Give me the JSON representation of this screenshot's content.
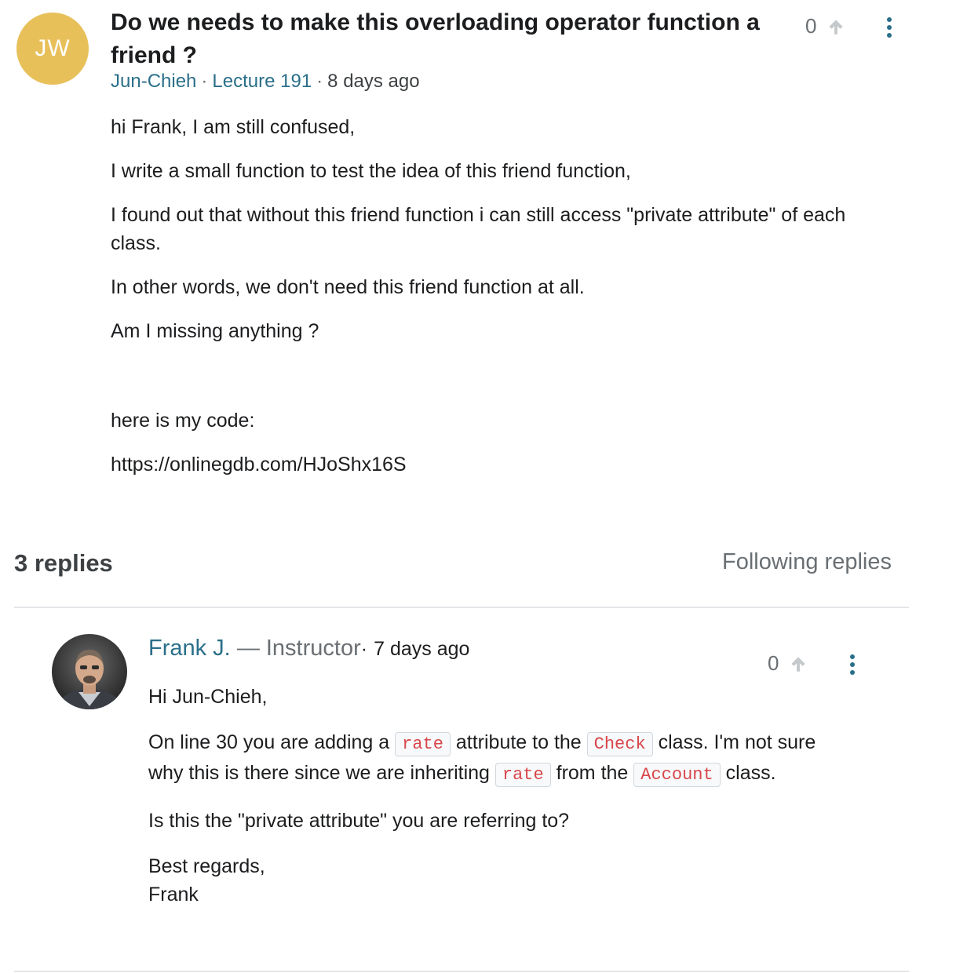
{
  "question": {
    "avatar_initials": "JW",
    "title": "Do we needs to make this overloading operator function a friend ?",
    "author": "Jun-Chieh",
    "meta_sep_1": "·",
    "lecture": "Lecture 191",
    "meta_sep_2": "·",
    "time": "8 days ago",
    "votes": "0",
    "body": [
      "hi Frank, I am still confused,",
      "I write a small function to test the idea of this friend function,",
      "I found out that without this friend function i can still access \"private attribute\" of each class.",
      "In other words, we don't need this friend function at all.",
      "Am I missing anything ?",
      "here is my code:",
      "https://onlinegdb.com/HJoShx16S"
    ]
  },
  "replies_header": {
    "count_label": "3 replies",
    "follow_label": "Following replies"
  },
  "reply": {
    "author": "Frank J.",
    "role": "— Instructor",
    "time_sep": "·",
    "time": "7 days ago",
    "votes": "0",
    "greeting": "Hi Jun-Chieh,",
    "p1_t1": "On line 30 you are adding a ",
    "p1_c1": "rate",
    "p1_t2": " attribute to the ",
    "p1_c2": "Check",
    "p1_t3": " class. I'm not sure why this is there since we are inheriting ",
    "p1_c3": "rate",
    "p1_t4": " from the ",
    "p1_c4": "Account",
    "p1_t5": " class.",
    "p2": "Is this the \"private attribute\" you are referring to?",
    "sign_1": "Best regards,",
    "sign_2": "Frank"
  },
  "colors": {
    "link": "#2a6f8a",
    "avatar_bg": "#e8c05a",
    "code_text": "#d8464b",
    "muted": "#6a6f73"
  },
  "icons": {
    "upvote": "arrow-up-icon",
    "more": "vertical-ellipsis-icon"
  }
}
